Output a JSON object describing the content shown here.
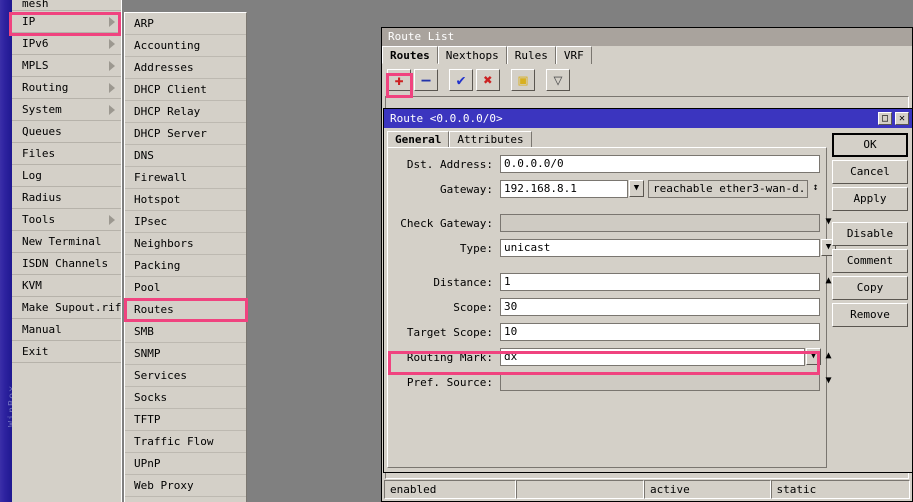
{
  "desktop": {
    "winbox_label": "WinBox",
    "background_color": "#808080"
  },
  "main_menu": {
    "partial_top_item": "mesh",
    "items": [
      {
        "label": "IP",
        "submenu": true,
        "highlighted": true
      },
      {
        "label": "IPv6",
        "submenu": true,
        "highlighted": false
      },
      {
        "label": "MPLS",
        "submenu": true,
        "highlighted": false
      },
      {
        "label": "Routing",
        "submenu": true,
        "highlighted": false
      },
      {
        "label": "System",
        "submenu": true,
        "highlighted": false
      },
      {
        "label": "Queues",
        "submenu": false,
        "highlighted": false
      },
      {
        "label": "Files",
        "submenu": false,
        "highlighted": false
      },
      {
        "label": "Log",
        "submenu": false,
        "highlighted": false
      },
      {
        "label": "Radius",
        "submenu": false,
        "highlighted": false
      },
      {
        "label": "Tools",
        "submenu": true,
        "highlighted": false
      },
      {
        "label": "New Terminal",
        "submenu": false,
        "highlighted": false
      },
      {
        "label": "ISDN Channels",
        "submenu": false,
        "highlighted": false
      },
      {
        "label": "KVM",
        "submenu": false,
        "highlighted": false
      },
      {
        "label": "Make Supout.rif",
        "submenu": false,
        "highlighted": false
      },
      {
        "label": "Manual",
        "submenu": false,
        "highlighted": false
      },
      {
        "label": "Exit",
        "submenu": false,
        "highlighted": false
      }
    ]
  },
  "ip_submenu": {
    "items": [
      {
        "label": "ARP",
        "highlighted": false
      },
      {
        "label": "Accounting",
        "highlighted": false
      },
      {
        "label": "Addresses",
        "highlighted": false
      },
      {
        "label": "DHCP Client",
        "highlighted": false
      },
      {
        "label": "DHCP Relay",
        "highlighted": false
      },
      {
        "label": "DHCP Server",
        "highlighted": false
      },
      {
        "label": "DNS",
        "highlighted": false
      },
      {
        "label": "Firewall",
        "highlighted": false
      },
      {
        "label": "Hotspot",
        "highlighted": false
      },
      {
        "label": "IPsec",
        "highlighted": false
      },
      {
        "label": "Neighbors",
        "highlighted": false
      },
      {
        "label": "Packing",
        "highlighted": false
      },
      {
        "label": "Pool",
        "highlighted": false
      },
      {
        "label": "Routes",
        "highlighted": true
      },
      {
        "label": "SMB",
        "highlighted": false
      },
      {
        "label": "SNMP",
        "highlighted": false
      },
      {
        "label": "Services",
        "highlighted": false
      },
      {
        "label": "Socks",
        "highlighted": false
      },
      {
        "label": "TFTP",
        "highlighted": false
      },
      {
        "label": "Traffic Flow",
        "highlighted": false
      },
      {
        "label": "UPnP",
        "highlighted": false
      },
      {
        "label": "Web Proxy",
        "highlighted": false
      }
    ]
  },
  "route_list_window": {
    "title": "Route List",
    "tabs": [
      {
        "label": "Routes",
        "active": true
      },
      {
        "label": "Nexthops",
        "active": false
      },
      {
        "label": "Rules",
        "active": false
      },
      {
        "label": "VRF",
        "active": false
      }
    ],
    "toolbar": [
      {
        "name": "add-button",
        "glyph": "✚",
        "color": "#cc2222",
        "highlighted": true
      },
      {
        "name": "remove-button",
        "glyph": "–",
        "color": "#2233aa",
        "highlighted": false
      },
      {
        "name": "enable-button",
        "glyph": "✔",
        "color": "#2233cc",
        "highlighted": false
      },
      {
        "name": "disable-button",
        "glyph": "✖",
        "color": "#cc2222",
        "highlighted": false
      },
      {
        "name": "comment-button",
        "glyph": "▣",
        "color": "#d8b020",
        "highlighted": false
      },
      {
        "name": "filter-button",
        "glyph": "▽",
        "color": "#555555",
        "highlighted": false
      }
    ],
    "status_cells": [
      "enabled",
      "",
      "active",
      "static"
    ]
  },
  "route_dialog": {
    "title": "Route <0.0.0.0/0>",
    "window_controls": {
      "maximize": "□",
      "close": "✕"
    },
    "tabs": [
      {
        "label": "General",
        "active": true
      },
      {
        "label": "Attributes",
        "active": false
      }
    ],
    "fields": [
      {
        "label": "Dst. Address:",
        "value": "0.0.0.0/0"
      },
      {
        "label": "Gateway:",
        "value": "192.168.8.1",
        "status": "reachable ether3-wan-d..."
      },
      {
        "label": "Check Gateway:",
        "value": ""
      },
      {
        "label": "Type:",
        "value": "unicast"
      },
      {
        "label": "Distance:",
        "value": "1"
      },
      {
        "label": "Scope:",
        "value": "30"
      },
      {
        "label": "Target Scope:",
        "value": "10"
      },
      {
        "label": "Routing Mark:",
        "value": "dx",
        "highlighted": true
      },
      {
        "label": "Pref. Source:",
        "value": ""
      }
    ],
    "buttons": [
      {
        "label": "OK",
        "primary": true
      },
      {
        "label": "Cancel",
        "primary": false
      },
      {
        "label": "Apply",
        "primary": false
      },
      {
        "label": "Disable",
        "primary": false
      },
      {
        "label": "Comment",
        "primary": false
      },
      {
        "label": "Copy",
        "primary": false
      },
      {
        "label": "Remove",
        "primary": false
      }
    ]
  },
  "highlight_color": "#f0437f"
}
